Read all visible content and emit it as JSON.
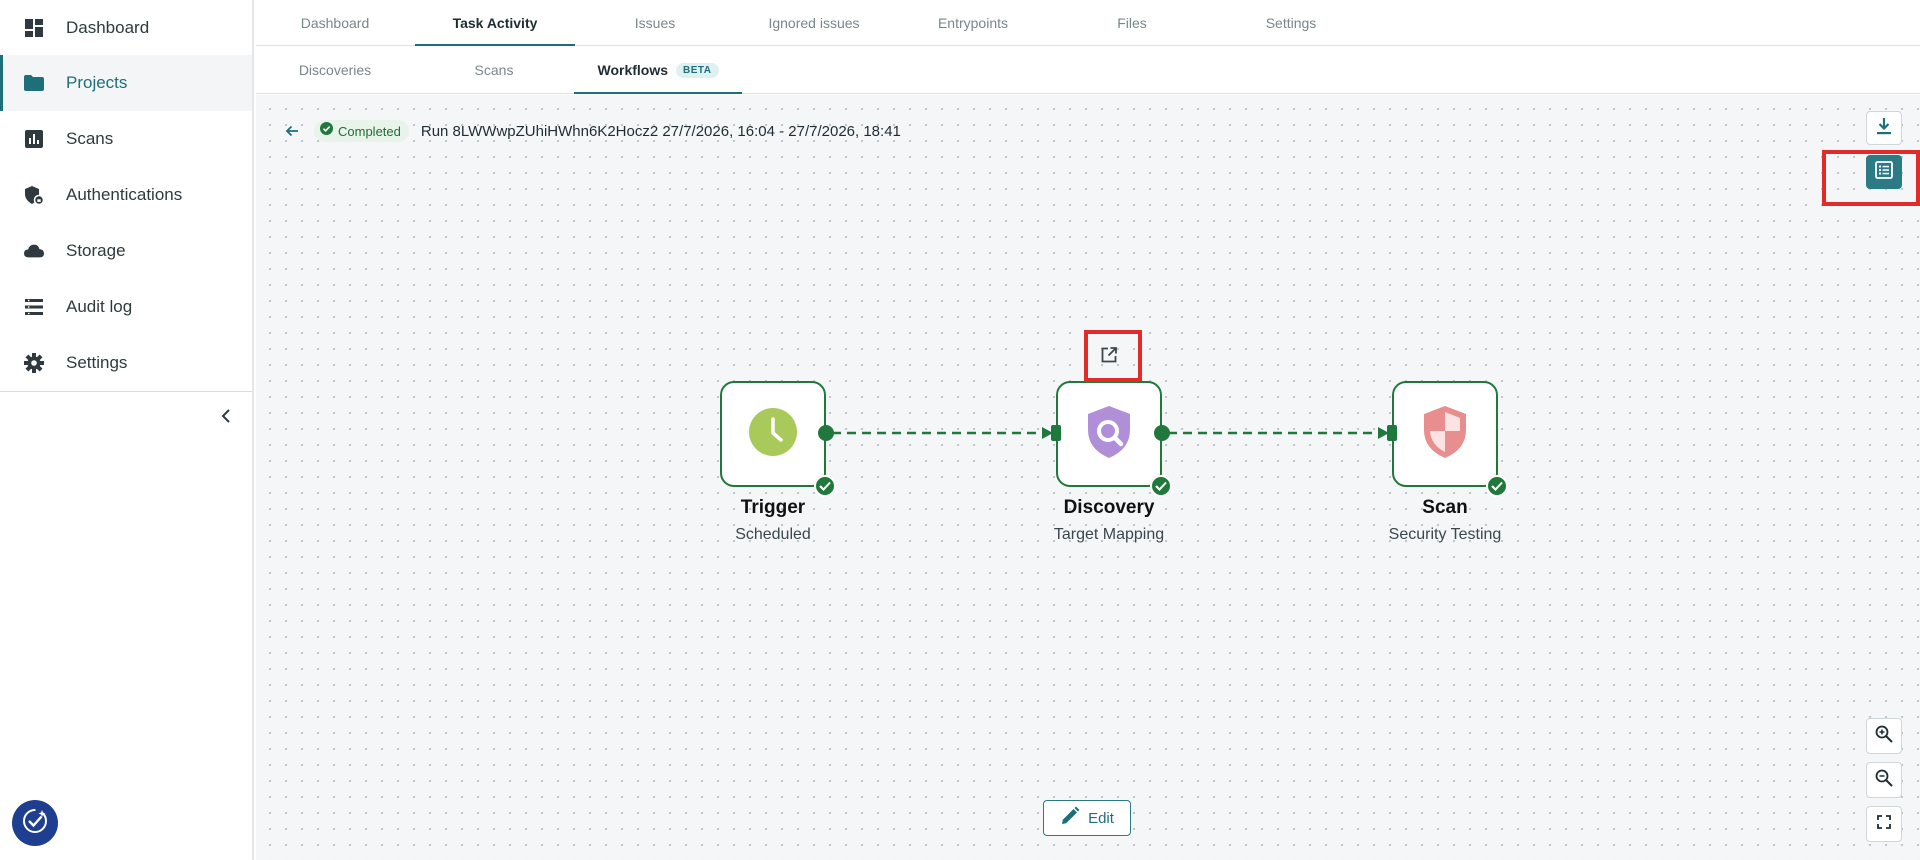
{
  "sidebar": {
    "items": [
      {
        "label": "Dashboard",
        "icon": "dashboard-icon"
      },
      {
        "label": "Projects",
        "icon": "folder-icon",
        "active": true
      },
      {
        "label": "Scans",
        "icon": "bar-chart-icon"
      },
      {
        "label": "Authentications",
        "icon": "shield-lock-icon"
      },
      {
        "label": "Storage",
        "icon": "cloud-icon"
      },
      {
        "label": "Audit log",
        "icon": "list-icon"
      },
      {
        "label": "Settings",
        "icon": "gear-icon"
      }
    ]
  },
  "tabs": {
    "top": [
      "Dashboard",
      "Task Activity",
      "Issues",
      "Ignored issues",
      "Entrypoints",
      "Files",
      "Settings"
    ],
    "top_active": "Task Activity",
    "sub": [
      "Discoveries",
      "Scans",
      "Workflows"
    ],
    "sub_active": "Workflows",
    "beta": "BETA"
  },
  "run": {
    "status": "Completed",
    "title": "Run 8LWWwpZUhiHWhn6K2Hocz2 27/7/2026, 16:04 - 27/7/2026, 18:41"
  },
  "workflow": {
    "nodes": [
      {
        "title": "Trigger",
        "subtitle": "Scheduled",
        "icon": "clock-icon",
        "status": "completed"
      },
      {
        "title": "Discovery",
        "subtitle": "Target Mapping",
        "icon": "shield-search-icon",
        "status": "completed"
      },
      {
        "title": "Scan",
        "subtitle": "Security Testing",
        "icon": "shield-half-icon",
        "status": "completed"
      }
    ]
  },
  "actions": {
    "edit": "Edit"
  },
  "colors": {
    "accent": "#1f6f7a",
    "success": "#21783c",
    "highlight": "#e02b2b",
    "trigger": "#a9c95a",
    "discovery": "#b08fd8",
    "scan": "#e88e8e"
  }
}
